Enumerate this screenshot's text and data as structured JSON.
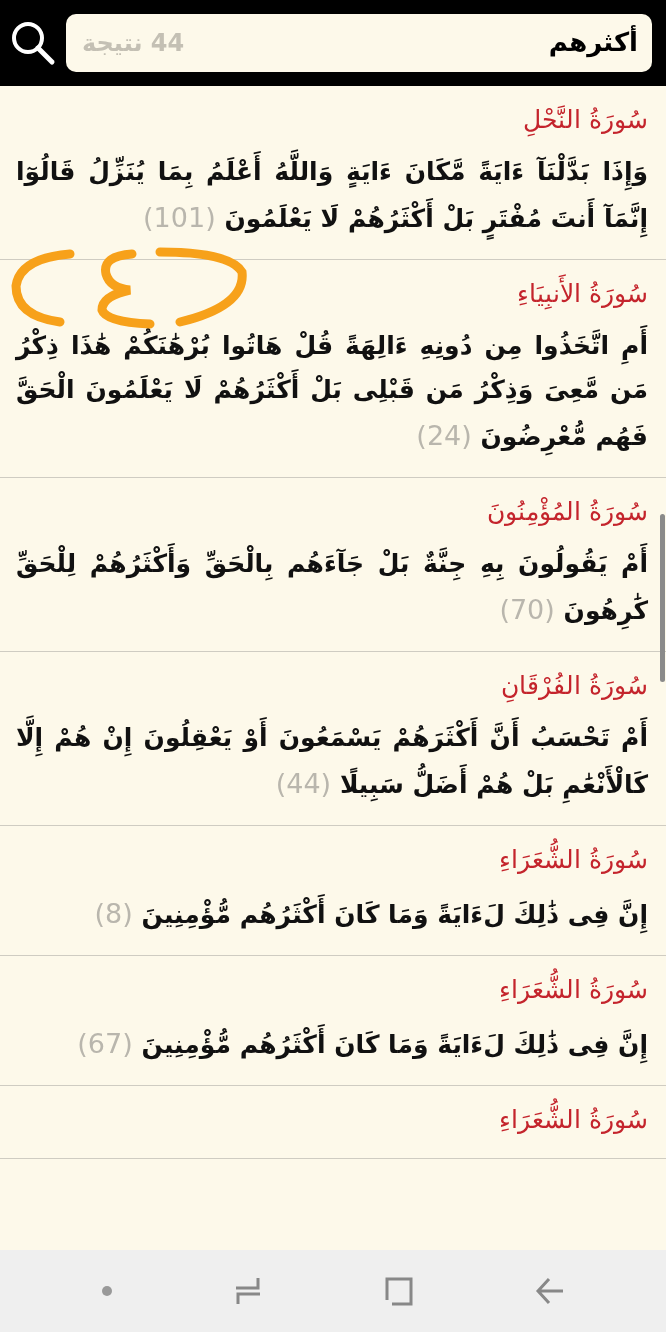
{
  "search": {
    "value": "أكثرهم",
    "result_count": "44 نتيجة"
  },
  "results": [
    {
      "surah": "سُورَةُ النَّحْلِ",
      "verse": "وَإِذَا بَدَّلْنَآ ءَايَةً مَّكَانَ ءَايَةٍ وَاللَّهُ أَعْلَمُ بِمَا يُنَزِّلُ قَالُوٓا إِنَّمَآ أَنتَ مُفْتَرٍ بَلْ أَكْثَرُهُمْ لَا يَعْلَمُونَ",
      "number": "(101)"
    },
    {
      "surah": "سُورَةُ الأَنبِيَاءِ",
      "verse": "أَمِ اتَّخَذُوا مِن دُونِهِ ءَالِهَةً قُلْ هَاتُوا بُرْهَٰنَكُمْ هَٰذَا ذِكْرُ مَن مَّعِىَ وَذِكْرُ مَن قَبْلِى بَلْ أَكْثَرُهُمْ لَا يَعْلَمُونَ الْحَقَّ فَهُم مُّعْرِضُونَ",
      "number": "(24)"
    },
    {
      "surah": "سُورَةُ المُؤْمِنُونَ",
      "verse": "أَمْ يَقُولُونَ بِهِ جِنَّةٌ بَلْ جَآءَهُم بِالْحَقِّ وَأَكْثَرُهُمْ لِلْحَقِّ كَٰرِهُونَ",
      "number": "(70)"
    },
    {
      "surah": "سُورَةُ الفُرْقَانِ",
      "verse": "أَمْ تَحْسَبُ أَنَّ أَكْثَرَهُمْ يَسْمَعُونَ أَوْ يَعْقِلُونَ إِنْ هُمْ إِلَّا كَالْأَنْعَٰمِ بَلْ هُمْ أَضَلُّ سَبِيلًا",
      "number": "(44)"
    },
    {
      "surah": "سُورَةُ الشُّعَرَاءِ",
      "verse": "إِنَّ فِى ذَٰلِكَ لَءَايَةً وَمَا كَانَ أَكْثَرُهُم مُّؤْمِنِينَ",
      "number": "(8)"
    },
    {
      "surah": "سُورَةُ الشُّعَرَاءِ",
      "verse": "إِنَّ فِى ذَٰلِكَ لَءَايَةً وَمَا كَانَ أَكْثَرُهُم مُّؤْمِنِينَ",
      "number": "(67)"
    },
    {
      "surah": "سُورَةُ الشُّعَرَاءِ"
    }
  ]
}
